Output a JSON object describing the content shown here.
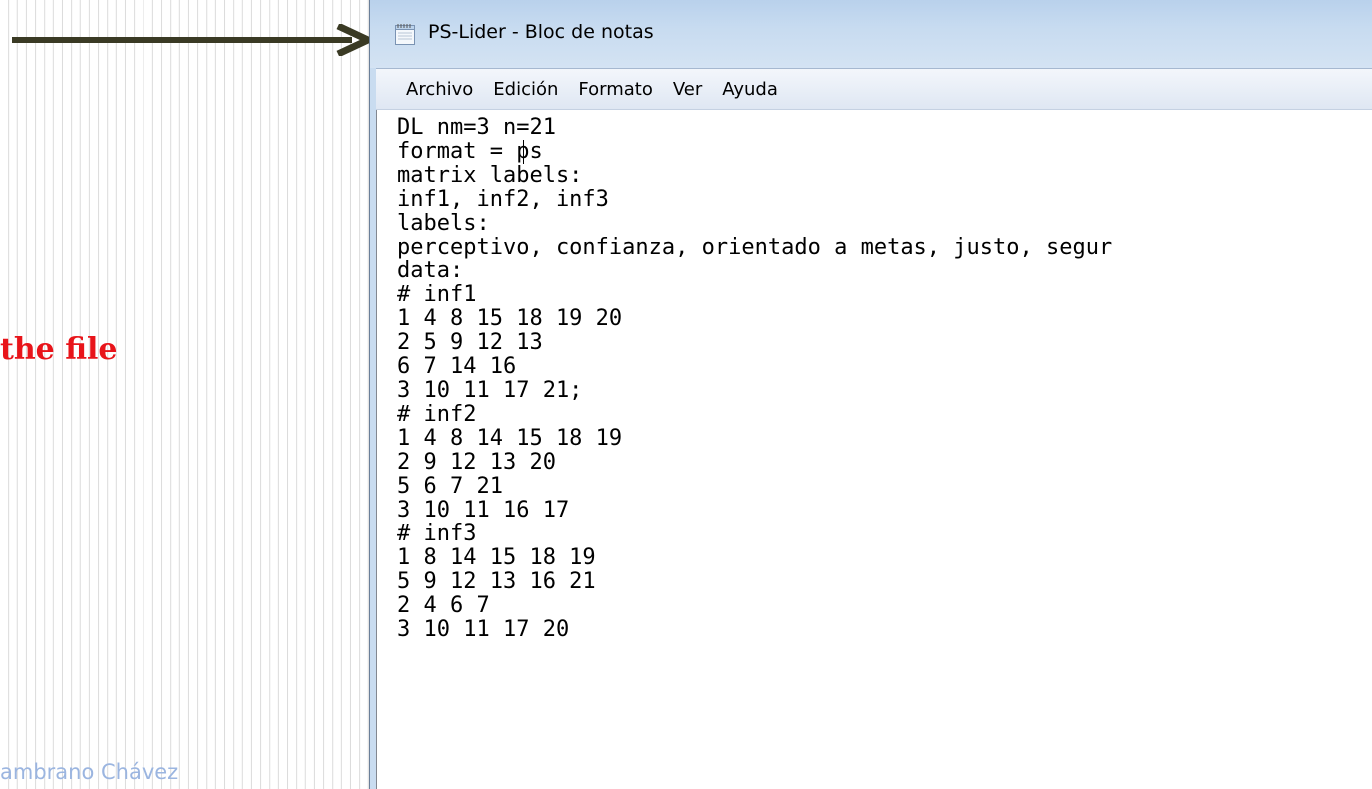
{
  "caption": "the file",
  "footer_credit": "ambrano Chávez",
  "window": {
    "title": "PS-Lider - Bloc de notas",
    "menu": [
      "Archivo",
      "Edición",
      "Formato",
      "Ver",
      "Ayuda"
    ],
    "content": "DL nm=3 n=21\nformat = ps\nmatrix labels:\ninf1, inf2, inf3\nlabels:\nperceptivo, confianza, orientado a metas, justo, segur\ndata:\n# inf1\n1 4 8 15 18 19 20\n2 5 9 12 13\n6 7 14 16\n3 10 11 17 21;\n# inf2\n1 4 8 14 15 18 19\n2 9 12 13 20\n5 6 7 21\n3 10 11 16 17\n# inf3\n1 8 14 15 18 19\n5 9 12 13 16 21\n2 4 6 7\n3 10 11 17 20"
  },
  "colors": {
    "caption": "#e8141a",
    "arrow": "#3a3a24",
    "footer_credit": "#9bb5e0"
  }
}
